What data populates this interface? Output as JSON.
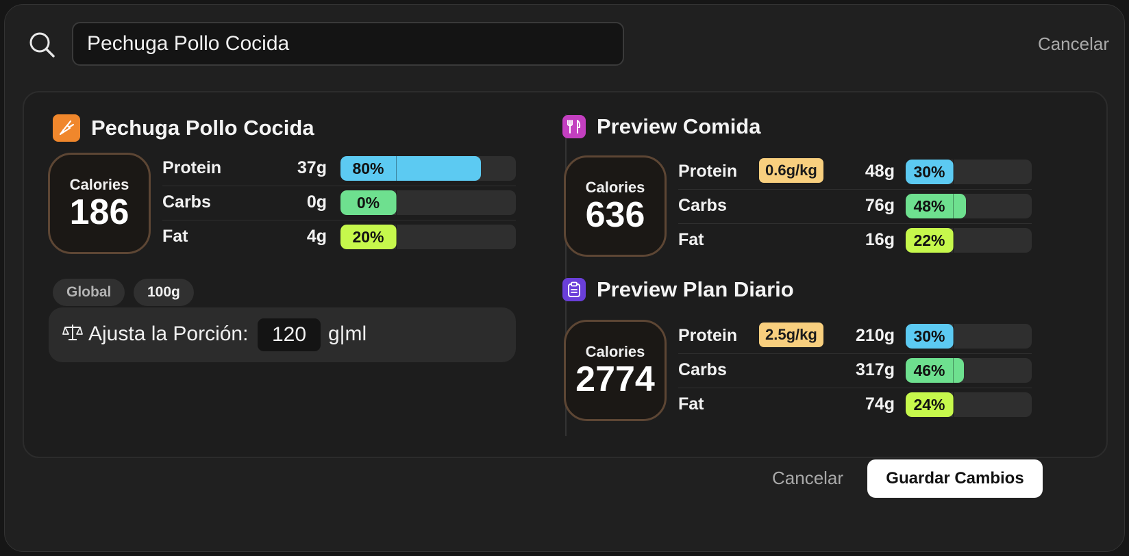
{
  "search": {
    "value": "Pechuga Pollo Cocida",
    "cancel_label": "Cancelar"
  },
  "food": {
    "title": "Pechuga Pollo Cocida",
    "icon": "carrot-icon",
    "icon_bg": "#f0872c",
    "calories_label": "Calories",
    "calories": "186",
    "macros": [
      {
        "name": "Protein",
        "grams": "37g",
        "pct_label": "80%",
        "pct": 80,
        "color": "#5ccaf2"
      },
      {
        "name": "Carbs",
        "grams": "0g",
        "pct_label": "0%",
        "pct": 0,
        "color": "#6ee08f"
      },
      {
        "name": "Fat",
        "grams": "4g",
        "pct_label": "20%",
        "pct": 20,
        "color": "#c6f84c"
      }
    ],
    "tags": [
      "Global",
      "100g"
    ],
    "portion": {
      "label": "Ajusta la Porción:",
      "value": "120",
      "unit": "g|ml",
      "icon": "scale-icon"
    }
  },
  "meal_preview": {
    "title": "Preview Comida",
    "icon": "utensils-icon",
    "icon_bg": "#c33fc0",
    "calories_label": "Calories",
    "calories": "636",
    "per_kg": "0.6g/kg",
    "macros": [
      {
        "name": "Protein",
        "grams": "48g",
        "pct_label": "30%",
        "pct": 30,
        "color": "#5ccaf2"
      },
      {
        "name": "Carbs",
        "grams": "76g",
        "pct_label": "48%",
        "pct": 48,
        "color": "#6ee08f"
      },
      {
        "name": "Fat",
        "grams": "16g",
        "pct_label": "22%",
        "pct": 22,
        "color": "#c6f84c"
      }
    ]
  },
  "daily_preview": {
    "title": "Preview Plan Diario",
    "icon": "clipboard-icon",
    "icon_bg": "#6a3fd9",
    "calories_label": "Calories",
    "calories": "2774",
    "per_kg": "2.5g/kg",
    "macros": [
      {
        "name": "Protein",
        "grams": "210g",
        "pct_label": "30%",
        "pct": 30,
        "color": "#5ccaf2"
      },
      {
        "name": "Carbs",
        "grams": "317g",
        "pct_label": "46%",
        "pct": 46,
        "color": "#6ee08f"
      },
      {
        "name": "Fat",
        "grams": "74g",
        "pct_label": "24%",
        "pct": 24,
        "color": "#c6f84c"
      }
    ]
  },
  "footer": {
    "cancel_label": "Cancelar",
    "save_label": "Guardar Cambios"
  }
}
